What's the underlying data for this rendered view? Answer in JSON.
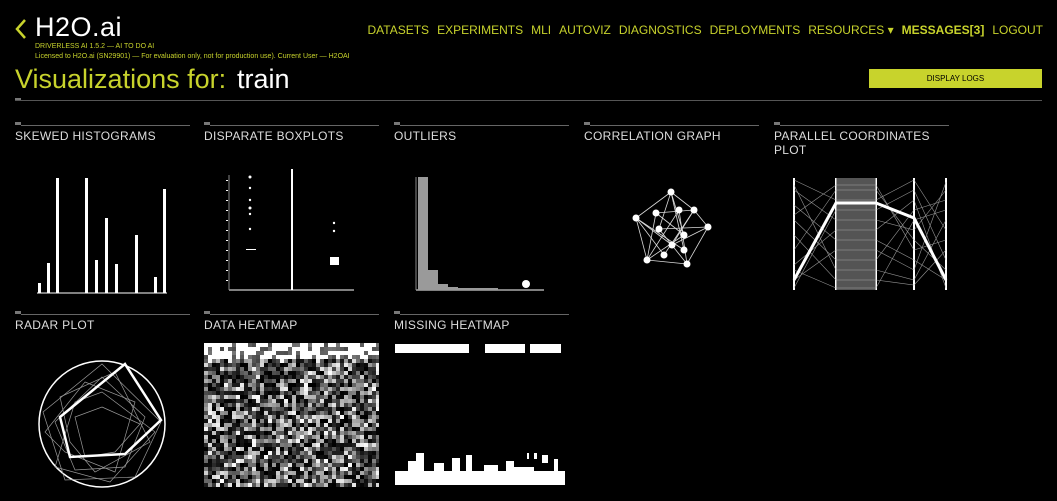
{
  "brand": {
    "name": "H2O.ai"
  },
  "app_info": {
    "version_line": "DRIVERLESS AI 1.5.2 — AI TO DO AI",
    "license_line": "Licensed to H2O.ai (SN29901) — For evaluation only, not for production use). Current User — H2OAI"
  },
  "nav": {
    "items": [
      "DATASETS",
      "EXPERIMENTS",
      "MLI",
      "AUTOVIZ",
      "DIAGNOSTICS",
      "DEPLOYMENTS",
      "RESOURCES ▾",
      "MESSAGES[3]",
      "LOGOUT"
    ]
  },
  "page": {
    "title_prefix": "Visualizations for:",
    "dataset_name": "train",
    "display_logs": "DISPLAY LOGS"
  },
  "cards": [
    "SKEWED HISTOGRAMS",
    "DISPARATE BOXPLOTS",
    "OUTLIERS",
    "CORRELATION GRAPH",
    "PARALLEL COORDINATES PLOT",
    "RADAR PLOT",
    "DATA HEATMAP",
    "MISSING HEATMAP"
  ],
  "colors": {
    "accent": "#c8d32c",
    "background": "#000000",
    "text": "#ffffff"
  }
}
